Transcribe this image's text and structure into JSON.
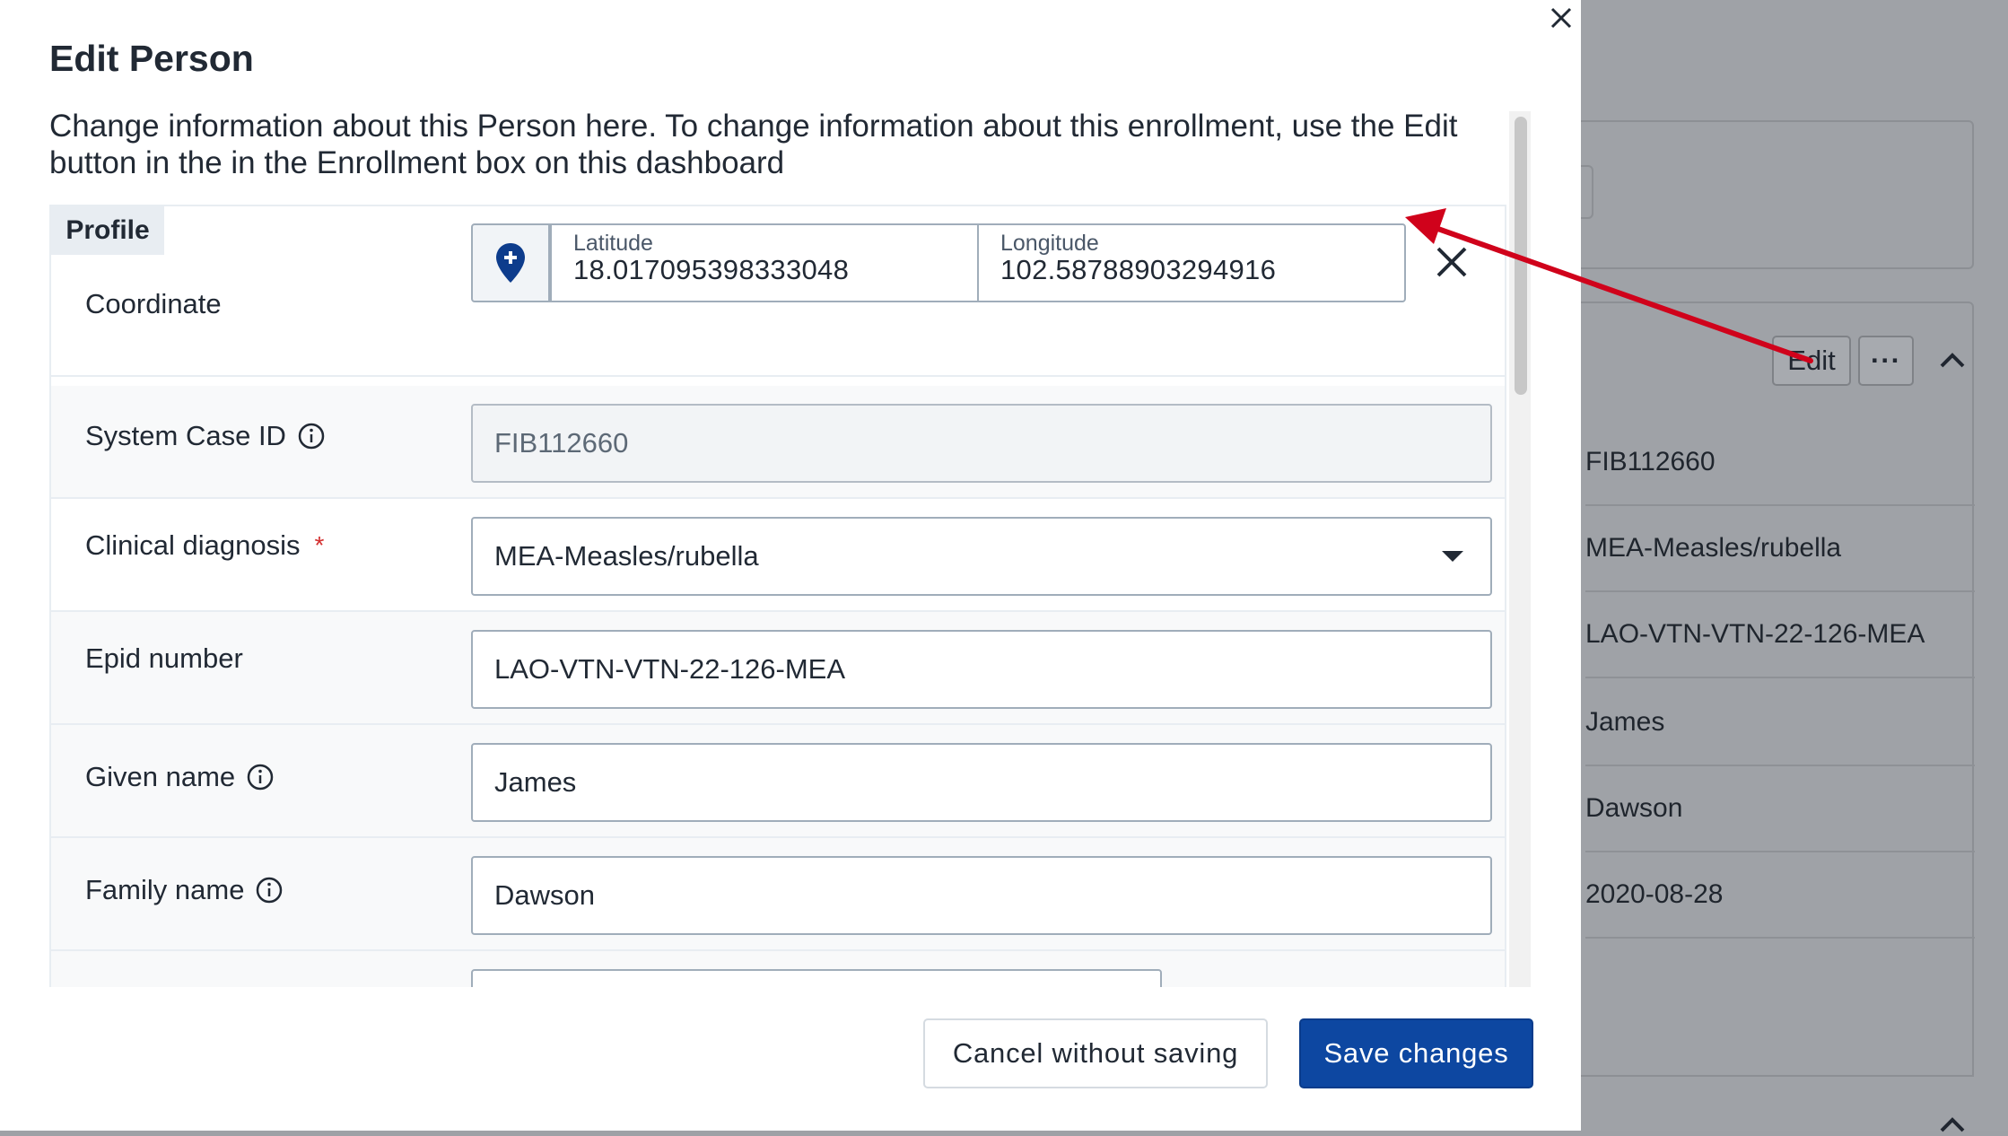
{
  "modal": {
    "title": "Edit Person",
    "intro": "Change information about this Person here. To change information about this enrollment, use the Edit button in the in the Enrollment box on this dashboard",
    "section_tab": "Profile",
    "coordinate": {
      "label": "Coordinate",
      "latitude_label": "Latitude",
      "latitude_value": "18.017095398333048",
      "longitude_label": "Longitude",
      "longitude_value": "102.58788903294916"
    },
    "fields": {
      "system_case_id": {
        "label": "System Case ID",
        "value": "FIB112660"
      },
      "clinical_diagnosis": {
        "label": "Clinical diagnosis",
        "required_mark": "*",
        "value": "MEA-Measles/rubella"
      },
      "epid_number": {
        "label": "Epid number",
        "value": "LAO-VTN-VTN-22-126-MEA"
      },
      "given_name": {
        "label": "Given name",
        "value": "James"
      },
      "family_name": {
        "label": "Family name",
        "value": "Dawson"
      }
    },
    "footer": {
      "cancel_label": "Cancel without saving",
      "save_label": "Save changes"
    }
  },
  "background": {
    "edit_label": "Edit",
    "more_label": "···",
    "values": [
      "FIB112660",
      "MEA-Measles/rubella",
      "LAO-VTN-VTN-22-126-MEA",
      "James",
      "Dawson",
      "2020-08-28"
    ]
  },
  "colors": {
    "primary": "#0d47a1",
    "pin": "#0d3c8c",
    "required": "#d32f2f",
    "annotation_arrow": "#d0021b"
  }
}
